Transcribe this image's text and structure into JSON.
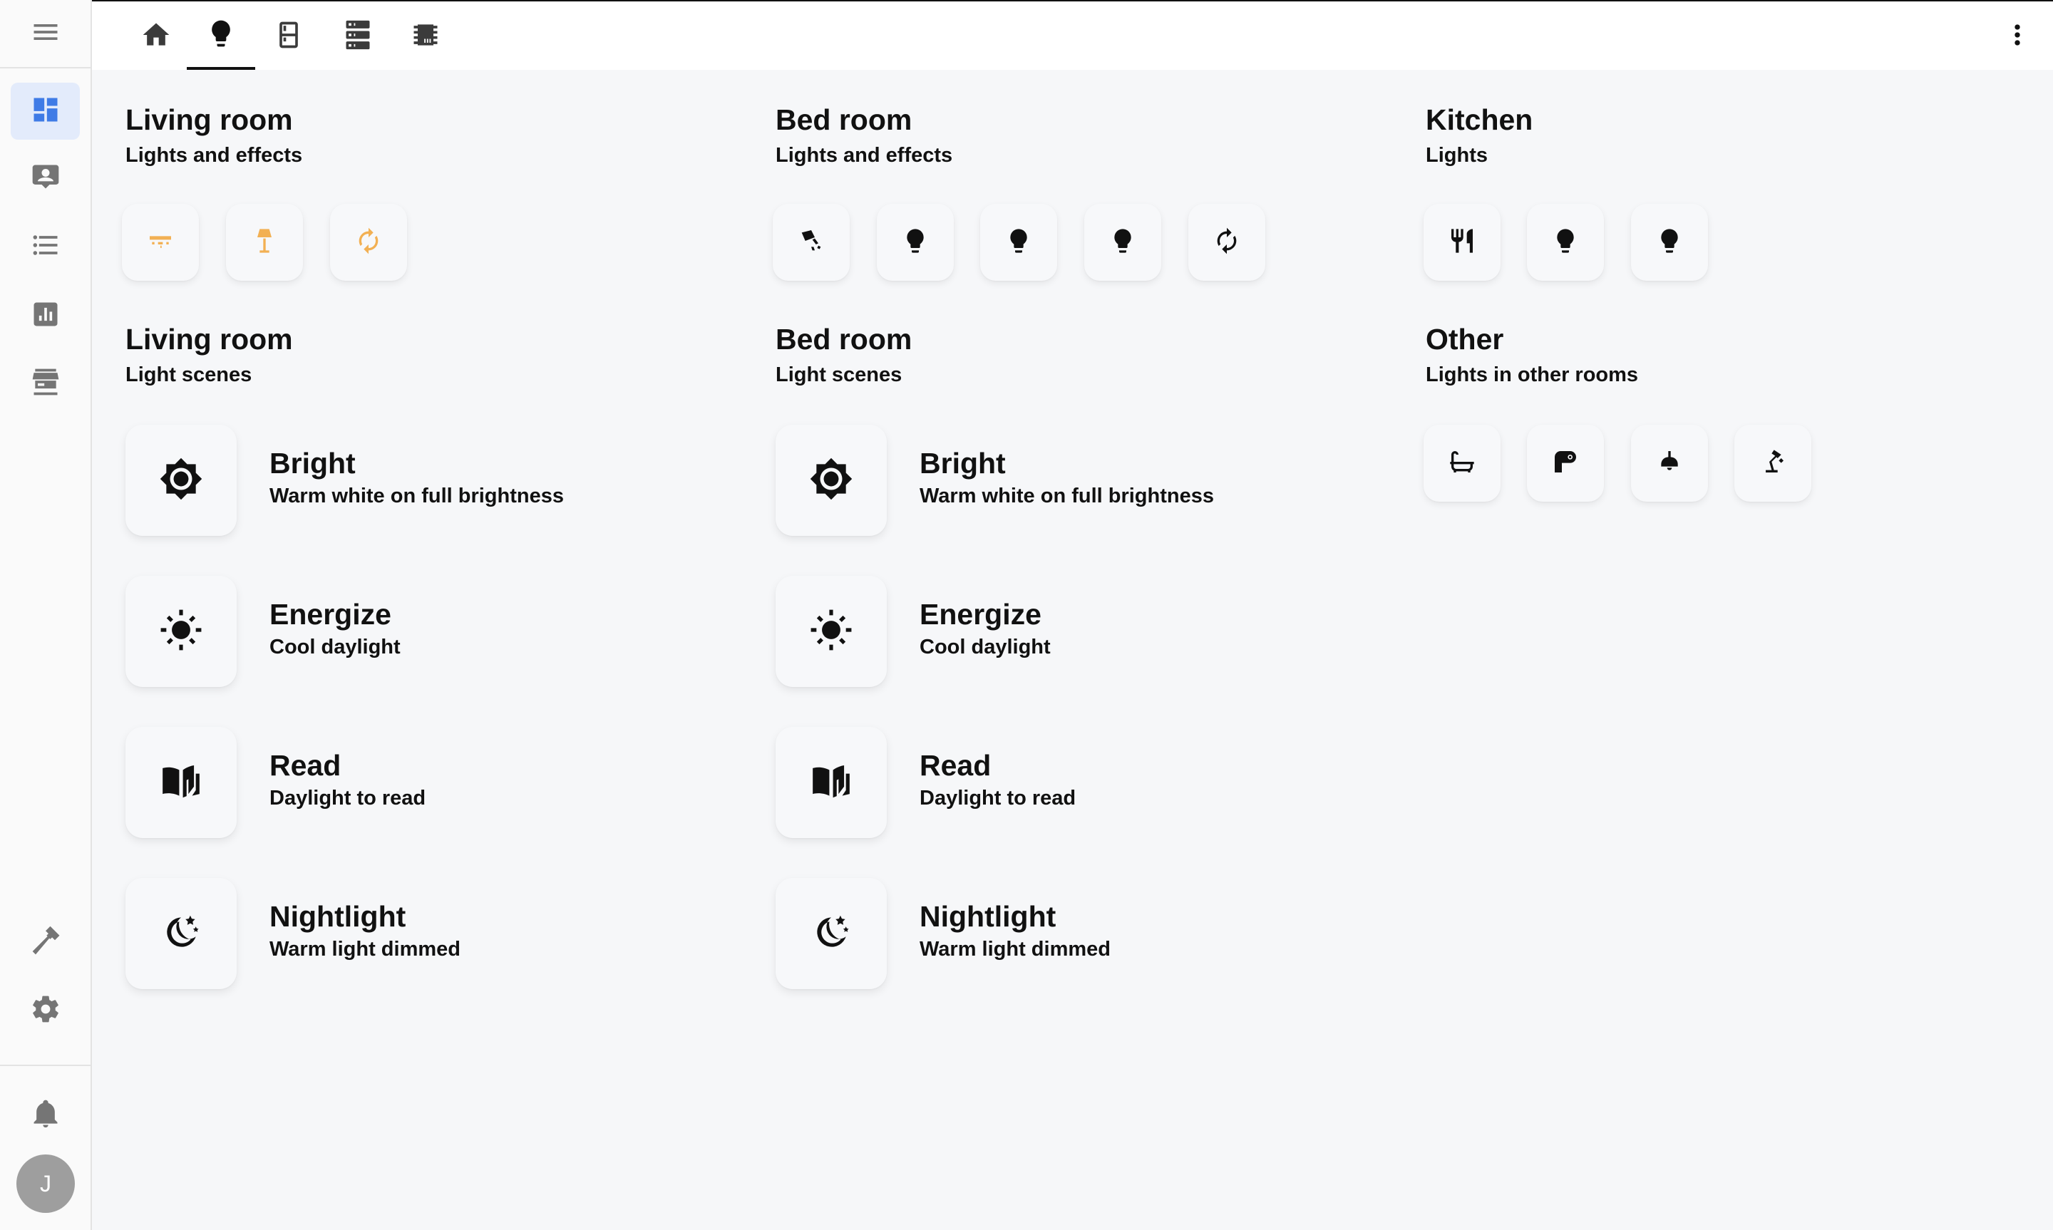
{
  "sidebar": {
    "menu_icon": "hamburger-menu-icon",
    "items": [
      {
        "name": "dashboard",
        "icon": "view-dashboard-icon",
        "active": true
      },
      {
        "name": "map",
        "icon": "account-box-icon"
      },
      {
        "name": "logbook",
        "icon": "format-list-bulleted-icon"
      },
      {
        "name": "history",
        "icon": "chart-box-icon"
      },
      {
        "name": "hacs",
        "icon": "hacs-store-icon"
      },
      {
        "name": "developer-tools",
        "icon": "hammer-icon"
      },
      {
        "name": "settings",
        "icon": "cog-icon"
      },
      {
        "name": "notifications",
        "icon": "bell-icon"
      }
    ],
    "avatar_initial": "J",
    "accent": "#3f7be6"
  },
  "topbar": {
    "tabs": [
      {
        "icon": "home-icon"
      },
      {
        "icon": "lightbulb-icon",
        "active": true
      },
      {
        "icon": "fridge-icon"
      },
      {
        "icon": "server-icon"
      },
      {
        "icon": "chip-icon"
      }
    ],
    "menu_icon": "dots-vertical-icon"
  },
  "sections": {
    "living_lights": {
      "title": "Living room",
      "subtitle": "Lights and effects",
      "chips": [
        "ceiling-light-icon",
        "floor-lamp-icon",
        "autorenew-icon"
      ],
      "chip_state": "on"
    },
    "bed_lights": {
      "title": "Bed room",
      "subtitle": "Lights and effects",
      "chips": [
        "spotlight-icon",
        "lightbulb-icon",
        "lightbulb-icon",
        "lightbulb-icon",
        "autorenew-icon"
      ]
    },
    "kitchen": {
      "title": "Kitchen",
      "subtitle": "Lights",
      "chips": [
        "silverware-fork-knife-icon",
        "lightbulb-icon",
        "lightbulb-icon"
      ]
    },
    "living_scenes": {
      "title": "Living room",
      "subtitle": "Light scenes",
      "scenes": [
        {
          "name": "Bright",
          "desc": "Warm white on full brightness",
          "icon": "brightness-icon"
        },
        {
          "name": "Energize",
          "desc": "Cool daylight",
          "icon": "sun-icon"
        },
        {
          "name": "Read",
          "desc": "Daylight to read",
          "icon": "book-open-icon"
        },
        {
          "name": "Nightlight",
          "desc": "Warm light dimmed",
          "icon": "moon-stars-icon"
        }
      ]
    },
    "bed_scenes": {
      "title": "Bed room",
      "subtitle": "Light scenes",
      "scenes": [
        {
          "name": "Bright",
          "desc": "Warm white on full brightness",
          "icon": "brightness-icon"
        },
        {
          "name": "Energize",
          "desc": "Cool daylight",
          "icon": "sun-icon"
        },
        {
          "name": "Read",
          "desc": "Daylight to read",
          "icon": "book-open-icon"
        },
        {
          "name": "Nightlight",
          "desc": "Warm light dimmed",
          "icon": "moon-stars-icon"
        }
      ]
    },
    "other": {
      "title": "Other",
      "subtitle": "Lights in other rooms",
      "chips": [
        "bathtub-icon",
        "toilet-paper-icon",
        "pendant-lamp-icon",
        "desk-lamp-icon"
      ]
    }
  },
  "colors": {
    "light_on": "#f2b053",
    "background": "#f6f7f9"
  }
}
